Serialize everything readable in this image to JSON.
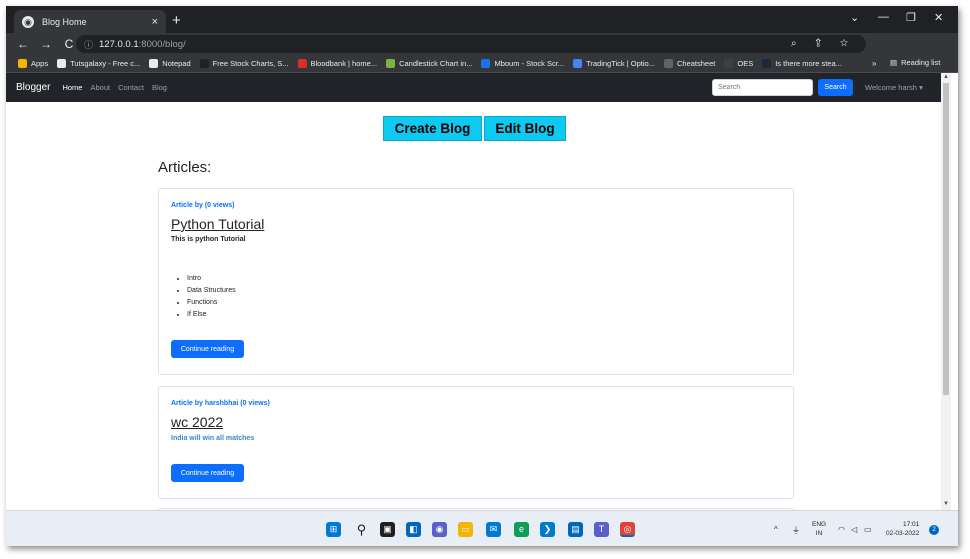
{
  "browser": {
    "tab_title": "Blog Home",
    "tab_close": "×",
    "new_tab": "+",
    "window_controls": {
      "chevron": "⌄",
      "minimize": "—",
      "maximize": "❐",
      "close": "✕"
    },
    "nav": {
      "back": "←",
      "forward": "→",
      "reload": "C"
    },
    "url_host": "127.0.0.1",
    "url_path": ":8000/blog/",
    "address_icons": "⌕ ⇪ ☆",
    "extensions_icon": "✱",
    "menu_icon": "⋮",
    "bookmarks": [
      {
        "label": "Apps",
        "icon": "apps-icon",
        "color": "#f4b400"
      },
      {
        "label": "Tutsgalaxy - Free c...",
        "icon": "globe-icon",
        "color": "#e8eaed"
      },
      {
        "label": "Notepad",
        "icon": "globe-icon",
        "color": "#e8eaed"
      },
      {
        "label": "Free Stock Charts, S...",
        "icon": "tradingview-icon",
        "color": "#202124"
      },
      {
        "label": "Bloodbank | home...",
        "icon": "bloodbank-icon",
        "color": "#d93025"
      },
      {
        "label": "Candlestick Chart in...",
        "icon": "candlestick-icon",
        "color": "#7cb342"
      },
      {
        "label": "Mboum - Stock Scr...",
        "icon": "mboum-icon",
        "color": "#1a73e8"
      },
      {
        "label": "TradingTick | Optio...",
        "icon": "tradingtick-icon",
        "color": "#4285f4"
      },
      {
        "label": "Cheatsheet",
        "icon": "cheatsheet-icon",
        "color": "#5f6368"
      },
      {
        "label": "OES",
        "icon": "oes-icon",
        "color": "#3c4043"
      },
      {
        "label": "Is there more stea...",
        "icon": "steam-icon",
        "color": "#1b2838"
      }
    ],
    "bookmarks_overflow": "»",
    "reading_list": "Reading list"
  },
  "site": {
    "brand": "Blogger",
    "nav_links": [
      "Home",
      "About",
      "Contact",
      "Blog"
    ],
    "search_placeholder": "Search",
    "search_button": "Search",
    "welcome": "Welcome harsh",
    "create_blog": "Create Blog",
    "edit_blog": "Edit Blog",
    "articles_heading": "Articles:",
    "articles": [
      {
        "meta": "Article by (0 views)",
        "title": "Python Tutorial",
        "subtitle": "This is python Tutorial",
        "items": [
          "Intro",
          "Data Structures",
          "Functions",
          "If Else"
        ],
        "button": "Continue reading"
      },
      {
        "meta": "Article by harshbhai (0 views)",
        "title": "wc 2022",
        "subtitle": "India will win all matches",
        "button": "Continue reading"
      }
    ]
  },
  "taskbar": {
    "tray_chevron": "^",
    "lang_line1": "ENG",
    "lang_line2": "IN",
    "time": "17:01",
    "date": "02-03-2022",
    "notifications": "2"
  }
}
